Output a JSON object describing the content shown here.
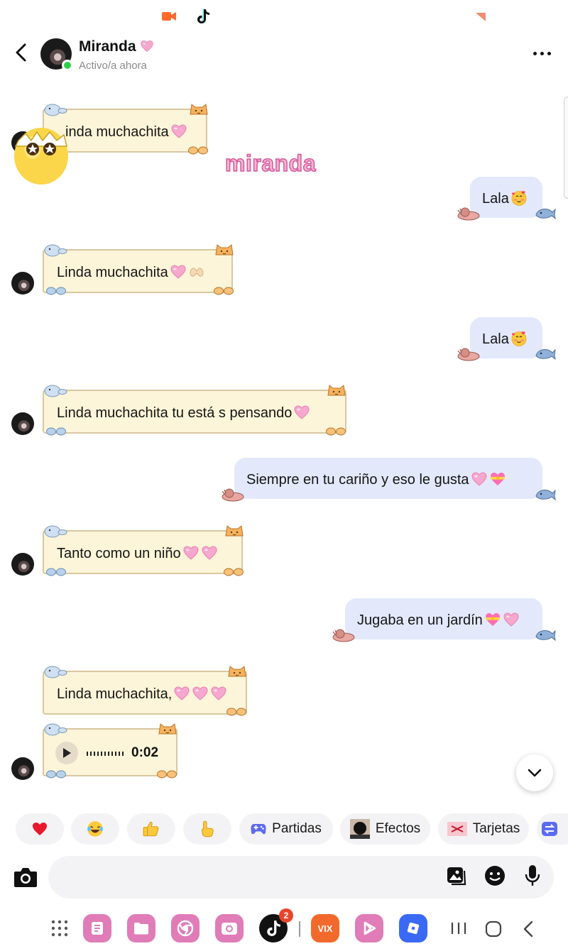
{
  "header": {
    "contact_name": "Miranda",
    "status": "Activo/a ahora"
  },
  "watermark": "miranda",
  "messages": [
    {
      "side": "in",
      "text": "inda muchachita",
      "emoji": [
        "pink-heart"
      ]
    },
    {
      "side": "out",
      "text": "Lala",
      "emoji": [
        "smiling-face-with-hearts"
      ]
    },
    {
      "side": "in",
      "text": "Linda  muchachita",
      "emoji": [
        "pink-heart",
        "heart-hands"
      ]
    },
    {
      "side": "out",
      "text": "Lala",
      "emoji": [
        "smiling-face-with-hearts"
      ]
    },
    {
      "side": "in",
      "text": "Linda muchachita tu está s pensando",
      "emoji": [
        "pink-heart"
      ]
    },
    {
      "side": "out",
      "text": "Siempre  en tu cariño y eso le gusta",
      "emoji": [
        "pink-heart",
        "heart-with-ribbon"
      ]
    },
    {
      "side": "in",
      "text": "Tanto como un niño",
      "emoji": [
        "pink-heart",
        "pink-heart"
      ]
    },
    {
      "side": "out",
      "text": "Jugaba en un jardín",
      "emoji": [
        "heart-with-ribbon",
        "pink-heart"
      ]
    },
    {
      "side": "in",
      "text": "Linda muchachita,",
      "emoji": [
        "pink-heart",
        "pink-heart",
        "pink-heart"
      ]
    }
  ],
  "audio": {
    "duration": "0:02"
  },
  "quick_replies": [
    {
      "icon": "heart-emoji",
      "label": ""
    },
    {
      "icon": "laughing-emoji",
      "label": ""
    },
    {
      "icon": "thumbs-up-emoji",
      "label": ""
    },
    {
      "icon": "pointing-emoji",
      "label": ""
    },
    {
      "icon": "gamepad-icon",
      "label": "Partidas"
    },
    {
      "icon": "effects-thumbnail",
      "label": "Efectos"
    },
    {
      "icon": "cards-thumbnail",
      "label": "Tarjetas"
    }
  ],
  "nav": {
    "tiktok_badge": "2",
    "vix_label": "VIX"
  },
  "colors": {
    "incoming_bubble": "#fdf5d9",
    "outgoing_bubble": "#e3e9fb",
    "online": "#2fcf4a",
    "watermark": "#f6b6d6"
  }
}
